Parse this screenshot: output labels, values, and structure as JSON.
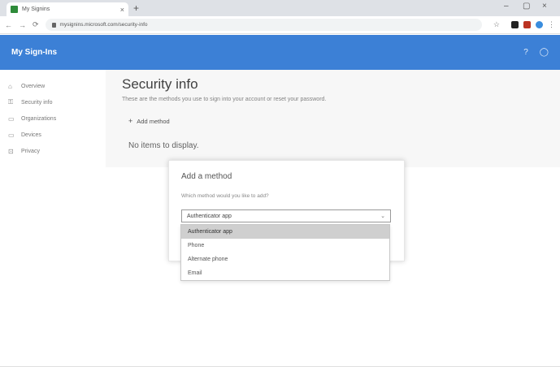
{
  "browser": {
    "tab_title": "My Signins",
    "tab_close": "×",
    "new_tab": "+",
    "url": "mysignins.microsoft.com/security-info",
    "win_min": "–",
    "win_max": "▢",
    "win_close": "×"
  },
  "header": {
    "app_title": "My Sign-Ins",
    "help_icon": "?",
    "account_icon": "◯"
  },
  "sidebar": {
    "items": [
      {
        "label": "Overview",
        "icon": "person-icon",
        "glyph": "⌂"
      },
      {
        "label": "Security info",
        "icon": "key-icon",
        "glyph": "⚿"
      },
      {
        "label": "Organizations",
        "icon": "briefcase-icon",
        "glyph": "▭"
      },
      {
        "label": "Devices",
        "icon": "laptop-icon",
        "glyph": "▭"
      },
      {
        "label": "Privacy",
        "icon": "lock-icon",
        "glyph": "⊡"
      }
    ]
  },
  "main": {
    "title": "Security info",
    "description": "These are the methods you use to sign into your account or reset your password.",
    "add_method_label": "Add method",
    "add_method_glyph": "+",
    "empty_text": "No items to display."
  },
  "dialog": {
    "title": "Add a method",
    "label": "Which method would you like to add?",
    "selected_value": "Authenticator app",
    "chevron": "⌄"
  },
  "dropdown": {
    "options": [
      {
        "label": "Authenticator app",
        "selected": true
      },
      {
        "label": "Phone",
        "selected": false
      },
      {
        "label": "Alternate phone",
        "selected": false
      },
      {
        "label": "Email",
        "selected": false
      }
    ]
  },
  "colors": {
    "header_bg": "#3c80d6",
    "option_selected_bg": "#cfcfcf"
  }
}
